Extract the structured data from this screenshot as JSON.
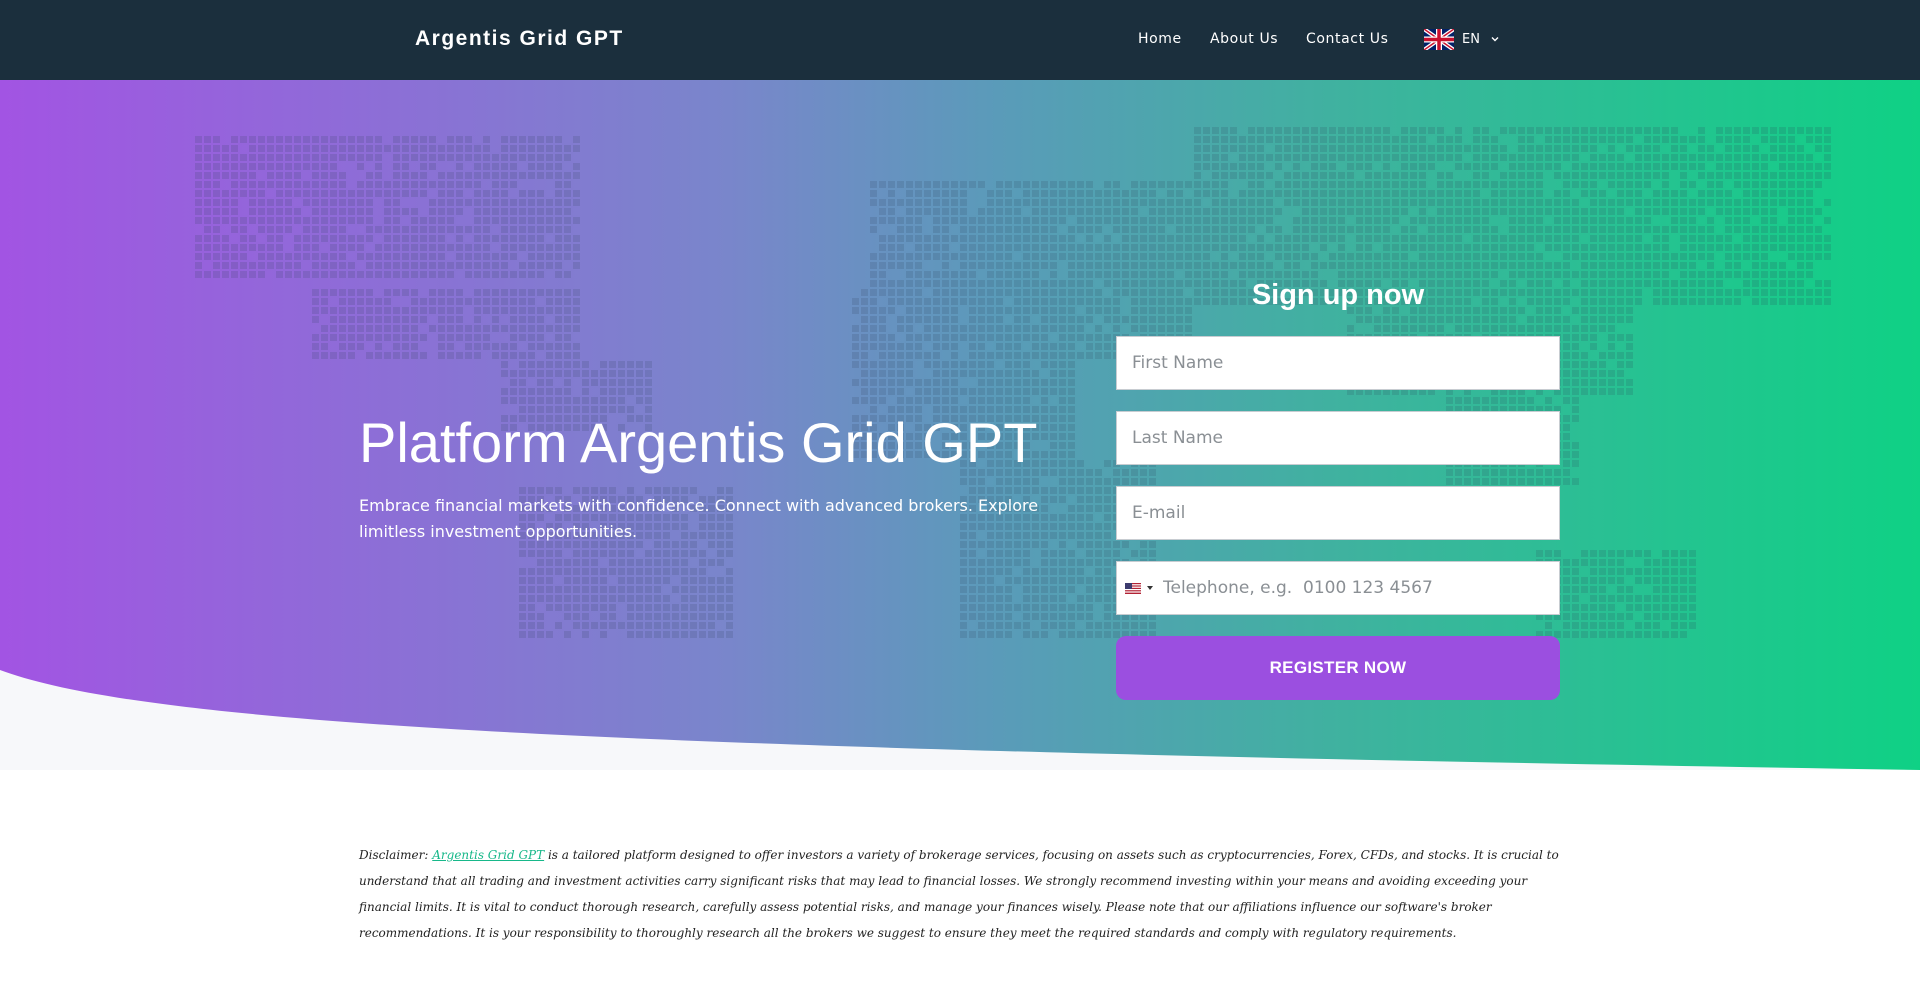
{
  "header": {
    "brand": "Argentis Grid GPT",
    "nav": [
      {
        "label": "Home"
      },
      {
        "label": "About Us"
      },
      {
        "label": "Contact Us"
      }
    ],
    "language": {
      "code": "EN",
      "flag_icon": "uk-flag-icon"
    }
  },
  "hero": {
    "title": "Platform Argentis Grid GPT",
    "subtitle": "Embrace financial markets with confidence. Connect with advanced brokers. Explore limitless investment opportunities."
  },
  "form": {
    "title": "Sign up now",
    "first_name_placeholder": "First Name",
    "last_name_placeholder": "Last Name",
    "email_placeholder": "E-mail",
    "phone_placeholder": "Telephone, e.g.  0100 123 4567",
    "phone_country_icon": "us-flag-icon",
    "submit_label": "REGISTER NOW"
  },
  "disclaimer": {
    "prefix": "Disclaimer: ",
    "link_text": "Argentis Grid GPT",
    "body": " is a tailored platform designed to offer investors a variety of brokerage services, focusing on assets such as cryptocurrencies, Forex, CFDs, and stocks. It is crucial to understand that all trading and investment activities carry significant risks that may lead to financial losses. We strongly recommend investing within your means and avoiding exceeding your financial limits. It is vital to conduct thorough research, carefully assess potential risks, and manage your finances wisely. Please note that our affiliations influence our software's broker recommendations. It is your responsibility to thoroughly research all the brokers we suggest to ensure they meet the required standards and comply with regulatory requirements."
  },
  "colors": {
    "header_bg": "#1b2f3d",
    "gradient_start": "#a254e3",
    "gradient_end": "#0fd185",
    "button": "#9b4fe0",
    "link": "#17b88a"
  }
}
